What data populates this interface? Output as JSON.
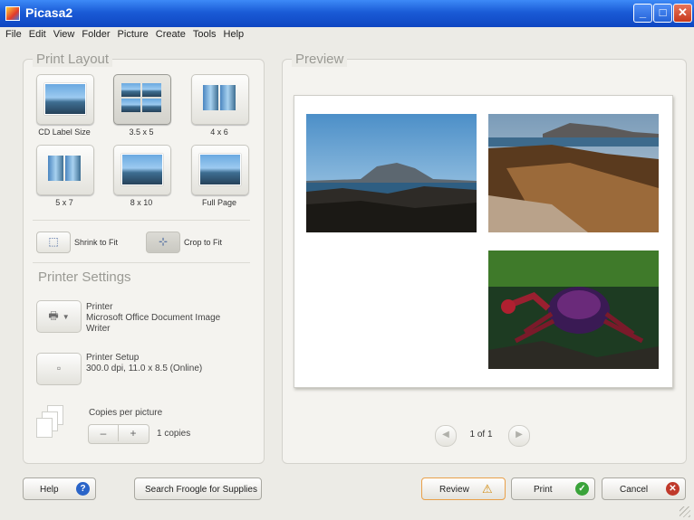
{
  "window": {
    "title": "Picasa2"
  },
  "menu": [
    "File",
    "Edit",
    "View",
    "Folder",
    "Picture",
    "Create",
    "Tools",
    "Help"
  ],
  "print_layout": {
    "title": "Print Layout",
    "options": [
      {
        "label": "CD Label Size",
        "icon": "cd-label-layout-icon"
      },
      {
        "label": "3.5 x 5",
        "icon": "four-up-layout-icon",
        "selected": true
      },
      {
        "label": "4 x 6",
        "icon": "two-up-layout-icon"
      },
      {
        "label": "5 x 7",
        "icon": "two-up-portrait-layout-icon"
      },
      {
        "label": "8 x 10",
        "icon": "single-layout-icon"
      },
      {
        "label": "Full Page",
        "icon": "full-page-layout-icon"
      }
    ],
    "shrink_to_fit": "Shrink to Fit",
    "crop_to_fit": "Crop to Fit"
  },
  "printer_settings": {
    "title": "Printer Settings",
    "printer_label": "Printer",
    "printer_name": "Microsoft Office Document Image Writer",
    "setup_label": "Printer Setup",
    "setup_value": "300.0 dpi, 11.0 x 8.5 (Online)",
    "copies_label": "Copies per picture",
    "minus": "–",
    "plus": "+",
    "copies_value": "1 copies"
  },
  "preview": {
    "title": "Preview",
    "page_indicator": "1 of 1"
  },
  "buttons": {
    "help": "Help",
    "froogle": "Search Froogle for Supplies",
    "review": "Review",
    "print": "Print",
    "cancel": "Cancel"
  },
  "colors": {
    "titlebar": "#1a5bd6",
    "print_ok": "#3aa33a",
    "cancel_x": "#c0392b",
    "help_q": "#2a64c8",
    "warn": "#f0b020"
  }
}
